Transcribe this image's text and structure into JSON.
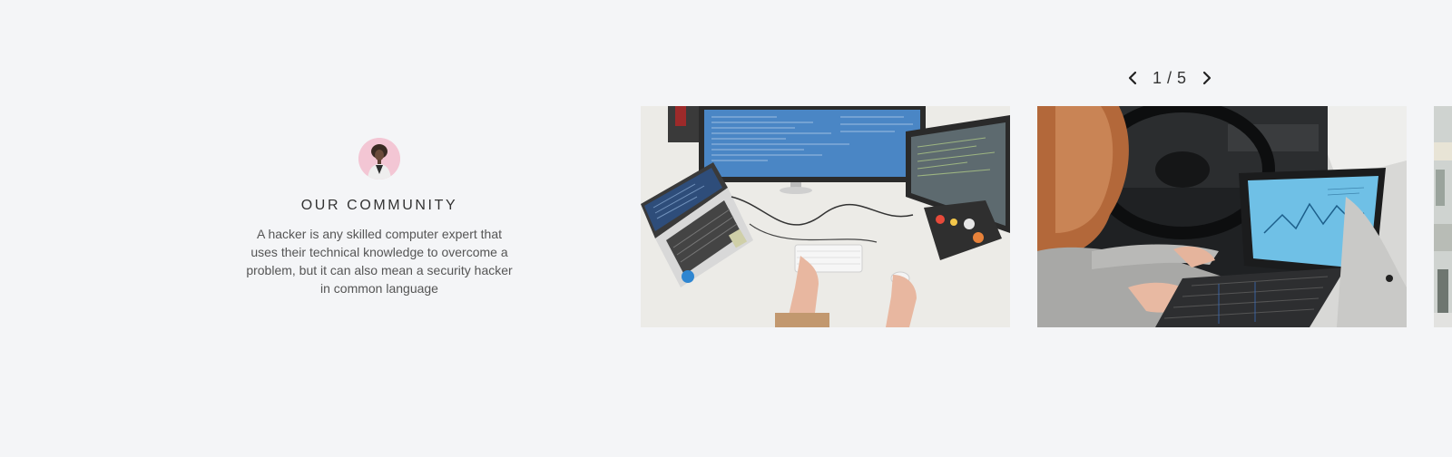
{
  "community": {
    "title": "OUR COMMUNITY",
    "description": "A hacker is any skilled computer expert that uses their technical knowledge to overcome a problem, but it can also mean a security hacker in common language",
    "avatar_icon": "person-avatar"
  },
  "slider": {
    "counter": "1 / 5",
    "prev_icon": "chevron-left-icon",
    "next_icon": "chevron-right-icon",
    "slides": [
      {
        "icon": "desk-computer-photo"
      },
      {
        "icon": "laptop-in-car-photo"
      },
      {
        "icon": "partial-photo"
      }
    ]
  },
  "colors": {
    "background": "#f4f5f7",
    "avatar_bg": "#f3c6d4",
    "text": "#333333"
  }
}
